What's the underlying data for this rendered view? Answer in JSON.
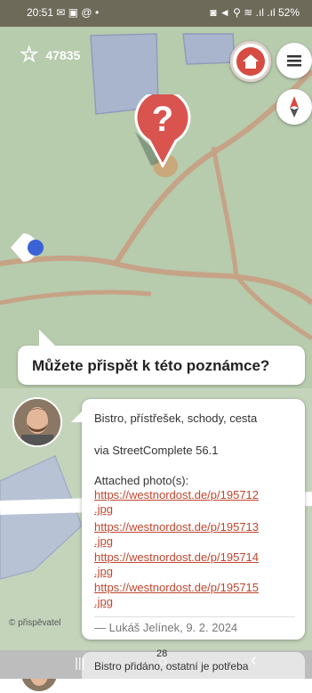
{
  "status_bar": {
    "time": "20:51",
    "left_icons": "✉ ▣ @ •",
    "right_icons": "◙ ◄ ⚲ ≋ .ıl .ıl",
    "battery": "52%"
  },
  "toolbar": {
    "star_count": "47835",
    "home_icon": "home-icon",
    "menu_icon": "menu-icon",
    "compass_icon": "compass-icon"
  },
  "note_marker": {
    "symbol": "?"
  },
  "prompt": {
    "question": "Můžete přispět k této poznámce?"
  },
  "comment": {
    "title": "Bistro, přístřešek, schody, cesta",
    "via": "via StreetComplete 56.1",
    "attached_label": "Attached photo(s):",
    "links": [
      {
        "line1": "https://westnordost.de/p/195712",
        "line2": ".jpg"
      },
      {
        "line1": "https://westnordost.de/p/195713",
        "line2": ".jpg"
      },
      {
        "line1": "https://westnordost.de/p/195714",
        "line2": ".jpg"
      },
      {
        "line1": "https://westnordost.de/p/195715",
        "line2": ".jpg"
      }
    ],
    "signature": "— Lukáš Jelínek, 9. 2. 2024"
  },
  "next_comment": {
    "number": "28",
    "text": "Bistro přidáno, ostatní je potřeba"
  },
  "attribution": "© přispěvatel",
  "nav": {
    "recents": "|||",
    "home": "○",
    "back": "‹"
  },
  "colors": {
    "map_bg": "#b8ccae",
    "building": "#a9b6cd",
    "road": "#c2a186",
    "marker": "#d9534f",
    "link": "#c0462e"
  }
}
